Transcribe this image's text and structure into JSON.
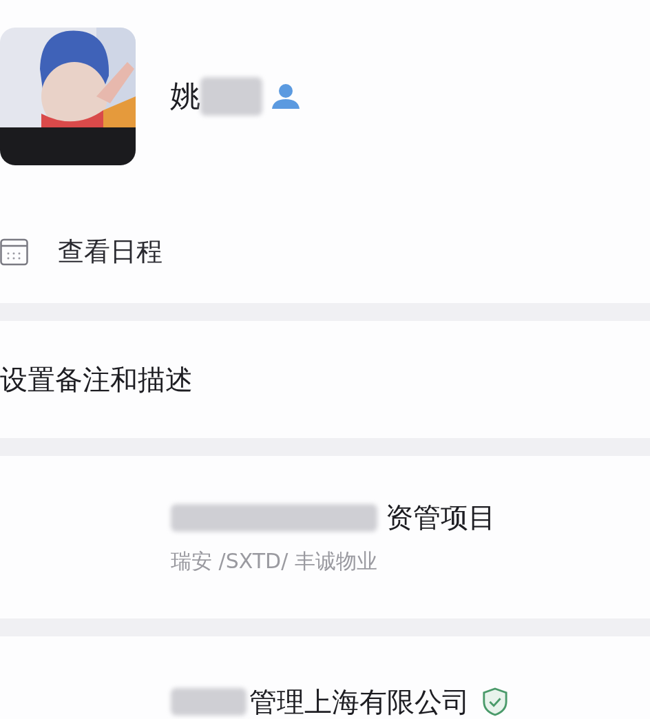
{
  "profile": {
    "name": "姚",
    "name_redacted": true
  },
  "schedule": {
    "label": "查看日程"
  },
  "remark": {
    "label": "设置备注和描述"
  },
  "organization": {
    "redacted": true,
    "title": "资管项目",
    "path": "瑞安 /SXTD/ 丰诚物业"
  },
  "company": {
    "redacted": true,
    "name": "管理上海有限公司",
    "verified": true
  }
}
